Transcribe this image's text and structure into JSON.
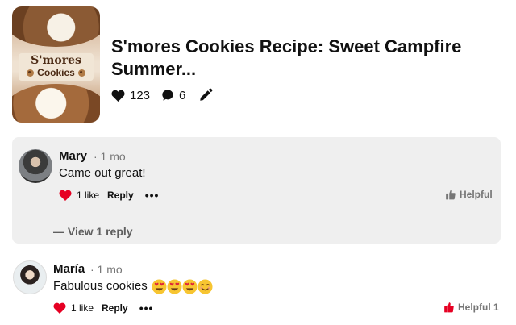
{
  "recipe": {
    "thumbnail_text_line1": "S'mores",
    "thumbnail_text_line2": "Cookies",
    "title": "S'mores Cookies Recipe: Sweet Campfire Summer...",
    "likes": "123",
    "comments": "6"
  },
  "comments": [
    {
      "author": "Mary",
      "time": "· 1 mo",
      "text": "Came out great!",
      "likes_label": "1 like",
      "reply_label": "Reply",
      "more_label": "•••",
      "helpful_label": "Helpful",
      "view_replies_label": "— View 1 reply",
      "heart_color": "#e60023",
      "helpful_icon_color": "#767676"
    },
    {
      "author": "María",
      "time": "· 1 mo",
      "text": "Fabulous cookies",
      "emojis": [
        "heart-eyes-emoji",
        "heart-eyes-emoji",
        "heart-eyes-emoji",
        "smiling-emoji"
      ],
      "likes_label": "1 like",
      "reply_label": "Reply",
      "more_label": "•••",
      "helpful_label": "Helpful 1",
      "heart_color": "#e60023",
      "helpful_icon_color": "#e60023"
    }
  ],
  "colors": {
    "highlight_background": "#efefef",
    "like_red": "#e60023",
    "muted_text": "#767676"
  }
}
